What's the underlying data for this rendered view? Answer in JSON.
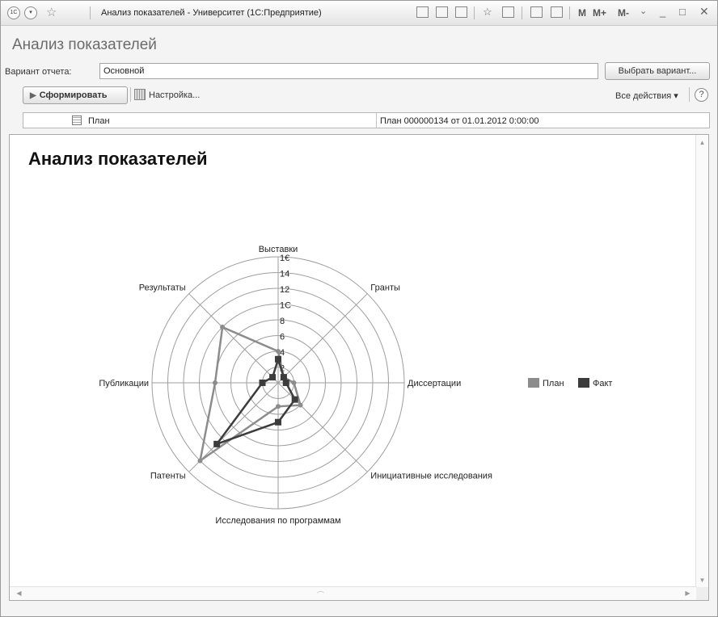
{
  "window": {
    "title": "Анализ показателей - Университет  (1С:Предприятие)",
    "logo": "1С",
    "m_buttons": [
      "M",
      "M+",
      "M-"
    ]
  },
  "form": {
    "title": "Анализ показателей",
    "variant_label": "Вариант отчета:",
    "variant_value": "Основной",
    "select_variant_label": "Выбрать вариант...",
    "generate_label": "Сформировать",
    "settings_label": "Настройка...",
    "all_actions_label": "Все действия",
    "help_label": "?"
  },
  "params": {
    "name": "План",
    "value": "План 000000134 от 01.01.2012 0:00:00"
  },
  "report": {
    "title": "Анализ показателей"
  },
  "chart_data": {
    "type": "radar",
    "categories": [
      "Выставки",
      "Гранты",
      "Диссертации",
      "Инициативные исследования",
      "Исследования по программам",
      "Патенты",
      "Публикации",
      "Результаты"
    ],
    "ticks": [
      "2",
      "4",
      "6",
      "8",
      "1С",
      "12",
      "14",
      "1€"
    ],
    "rmax": 16,
    "rings": 8,
    "series": [
      {
        "name": "План",
        "color": "#8c8c8c",
        "values": [
          4,
          1,
          2,
          4,
          3,
          14,
          8,
          10
        ]
      },
      {
        "name": "Факт",
        "color": "#3c3c3c",
        "values": [
          3,
          1,
          1,
          3,
          5,
          11,
          2,
          1
        ]
      }
    ]
  },
  "colors": {
    "plan": "#8c8c8c",
    "fact": "#3c3c3c"
  }
}
